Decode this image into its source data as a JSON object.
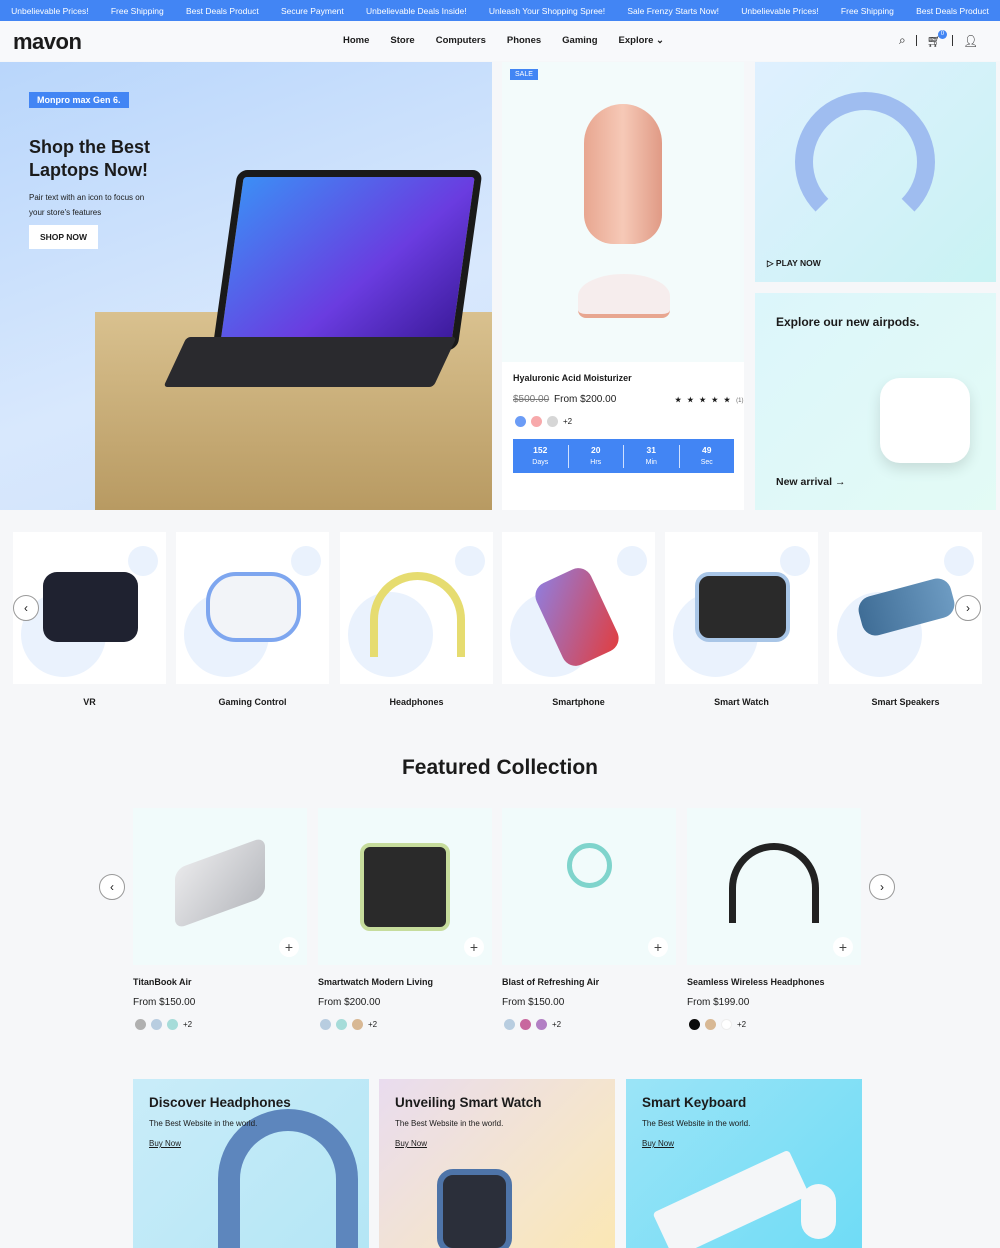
{
  "topbar": [
    "Unbelievable Prices!",
    "Free Shipping",
    "Best Deals Product",
    "Secure Payment",
    "Unbelievable Deals Inside!",
    "Unleash Your Shopping Spree!",
    "Sale Frenzy Starts Now!",
    "Unbelievable Prices!",
    "Free Shipping",
    "Best Deals Product"
  ],
  "header": {
    "logo": "mavon",
    "nav": [
      "Home",
      "Store",
      "Computers",
      "Phones",
      "Gaming",
      "Explore"
    ],
    "cart_count": "0",
    "icons": [
      "search-icon",
      "cart-icon",
      "user-icon"
    ]
  },
  "hero": {
    "tag": "Monpro max Gen 6.",
    "title": "Shop the Best Laptops Now!",
    "text": "Pair text with an icon to focus on your store's features",
    "button": "SHOP NOW"
  },
  "deal": {
    "badge": "SALE",
    "name": "Hyaluronic Acid Moisturizer",
    "old_price": "$500.00",
    "price": "From $200.00",
    "rating": 5,
    "stars": "★ ★ ★ ★ ★",
    "reviews": "(1)",
    "swatches": [
      "#6b9cf6",
      "#f7a9ab",
      "#d6d6d6"
    ],
    "more": "+2",
    "timer": [
      {
        "v": "152",
        "u": "Days"
      },
      {
        "v": "20",
        "u": "Hrs"
      },
      {
        "v": "31",
        "u": "Min"
      },
      {
        "v": "49",
        "u": "Sec"
      }
    ]
  },
  "promo_top": {
    "label": "PLAY NOW"
  },
  "promo_bottom": {
    "title": "Explore our new airpods.",
    "link": "New arrival →"
  },
  "categories": [
    "VR",
    "Gaming Control",
    "Headphones",
    "Smartphone",
    "Smart Watch",
    "Smart Speakers"
  ],
  "featured": {
    "title": "Featured Collection",
    "products": [
      {
        "name": "TitanBook Air",
        "price": "From $150.00",
        "swatches": [
          "#b0b0b0",
          "#b8cde0",
          "#a6dcd9"
        ],
        "more": "+2"
      },
      {
        "name": "Smartwatch Modern Living",
        "price": "From $200.00",
        "swatches": [
          "#b8cde0",
          "#a6dcd9",
          "#d8b894"
        ],
        "more": "+2"
      },
      {
        "name": "Blast of Refreshing Air",
        "price": "From $150.00",
        "swatches": [
          "#b8cde0",
          "#c8679e",
          "#b27fc4"
        ],
        "more": "+2"
      },
      {
        "name": "Seamless Wireless Headphones",
        "price": "From $199.00",
        "swatches": [
          "#0b0b0b",
          "#d8b894",
          "#ffffff"
        ],
        "more": "+2"
      }
    ]
  },
  "banners": [
    {
      "title": "Discover Headphones",
      "text": "The Best Website in the world.",
      "link": "Buy Now"
    },
    {
      "title": "Unveiling Smart Watch",
      "text": "The Best Website in the world.",
      "link": "Buy Now"
    },
    {
      "title": "Smart Keyboard",
      "text": "The Best Website in the world.",
      "link": "Buy Now"
    }
  ],
  "colors": {
    "accent": "#4285f4"
  }
}
